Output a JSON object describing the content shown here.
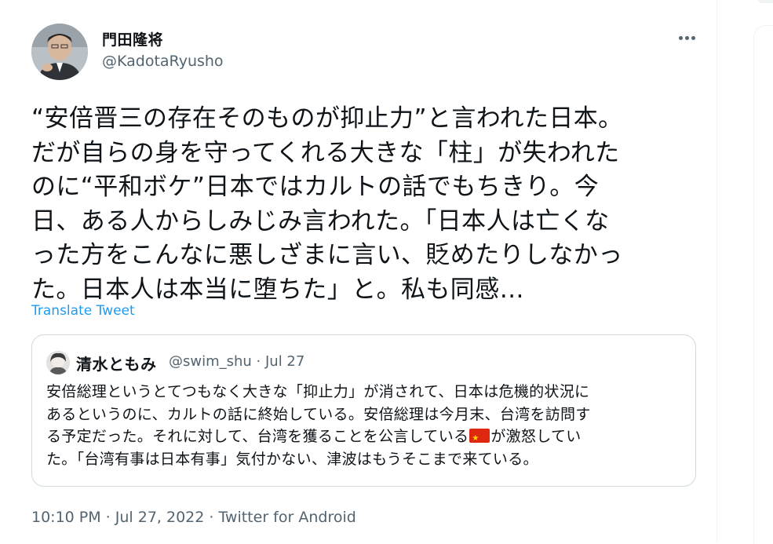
{
  "tweet": {
    "author_name": "門田隆将",
    "author_handle": "@KadotaRyusho",
    "body_lines": [
      "“安倍晋三の存在そのものが抑止力”と言われた日本。",
      "だが自らの身を守ってくれる大きな「柱」が失われた",
      "のに“平和ボケ”日本ではカルトの話でもちきり。今",
      "日、ある人からしみじみ言われた。「日本人は亡くな",
      "った方をこんなに悪しざまに言い、貶めたりしなかっ",
      "た。日本人は本当に堕ちた」と。私も同感…"
    ],
    "translate_label": "Translate Tweet",
    "timestamp": "10:10 PM · Jul 27, 2022 · Twitter for Android"
  },
  "quoted_tweet": {
    "author_name": "清水ともみ",
    "meta": "@swim_shu · Jul 27",
    "line1": "安倍総理というとてつもなく大きな「抑止力」が消されて、日本は危機的状況に",
    "line2": "あるというのに、カルトの話に終始している。安倍総理は今月末、台湾を訪問す",
    "line3_before": "る予定だった。それに対して、台湾を獲ることを公言している",
    "line3_after": "が激怒してい",
    "line4": "た。「台湾有事は日本有事」気付かない、津波はもうそこまで来ている。",
    "flag_icon": "china-flag-emoji"
  },
  "colors": {
    "link": "#1d9bf0",
    "secondary_text": "#536471",
    "border": "#cfd9de"
  }
}
